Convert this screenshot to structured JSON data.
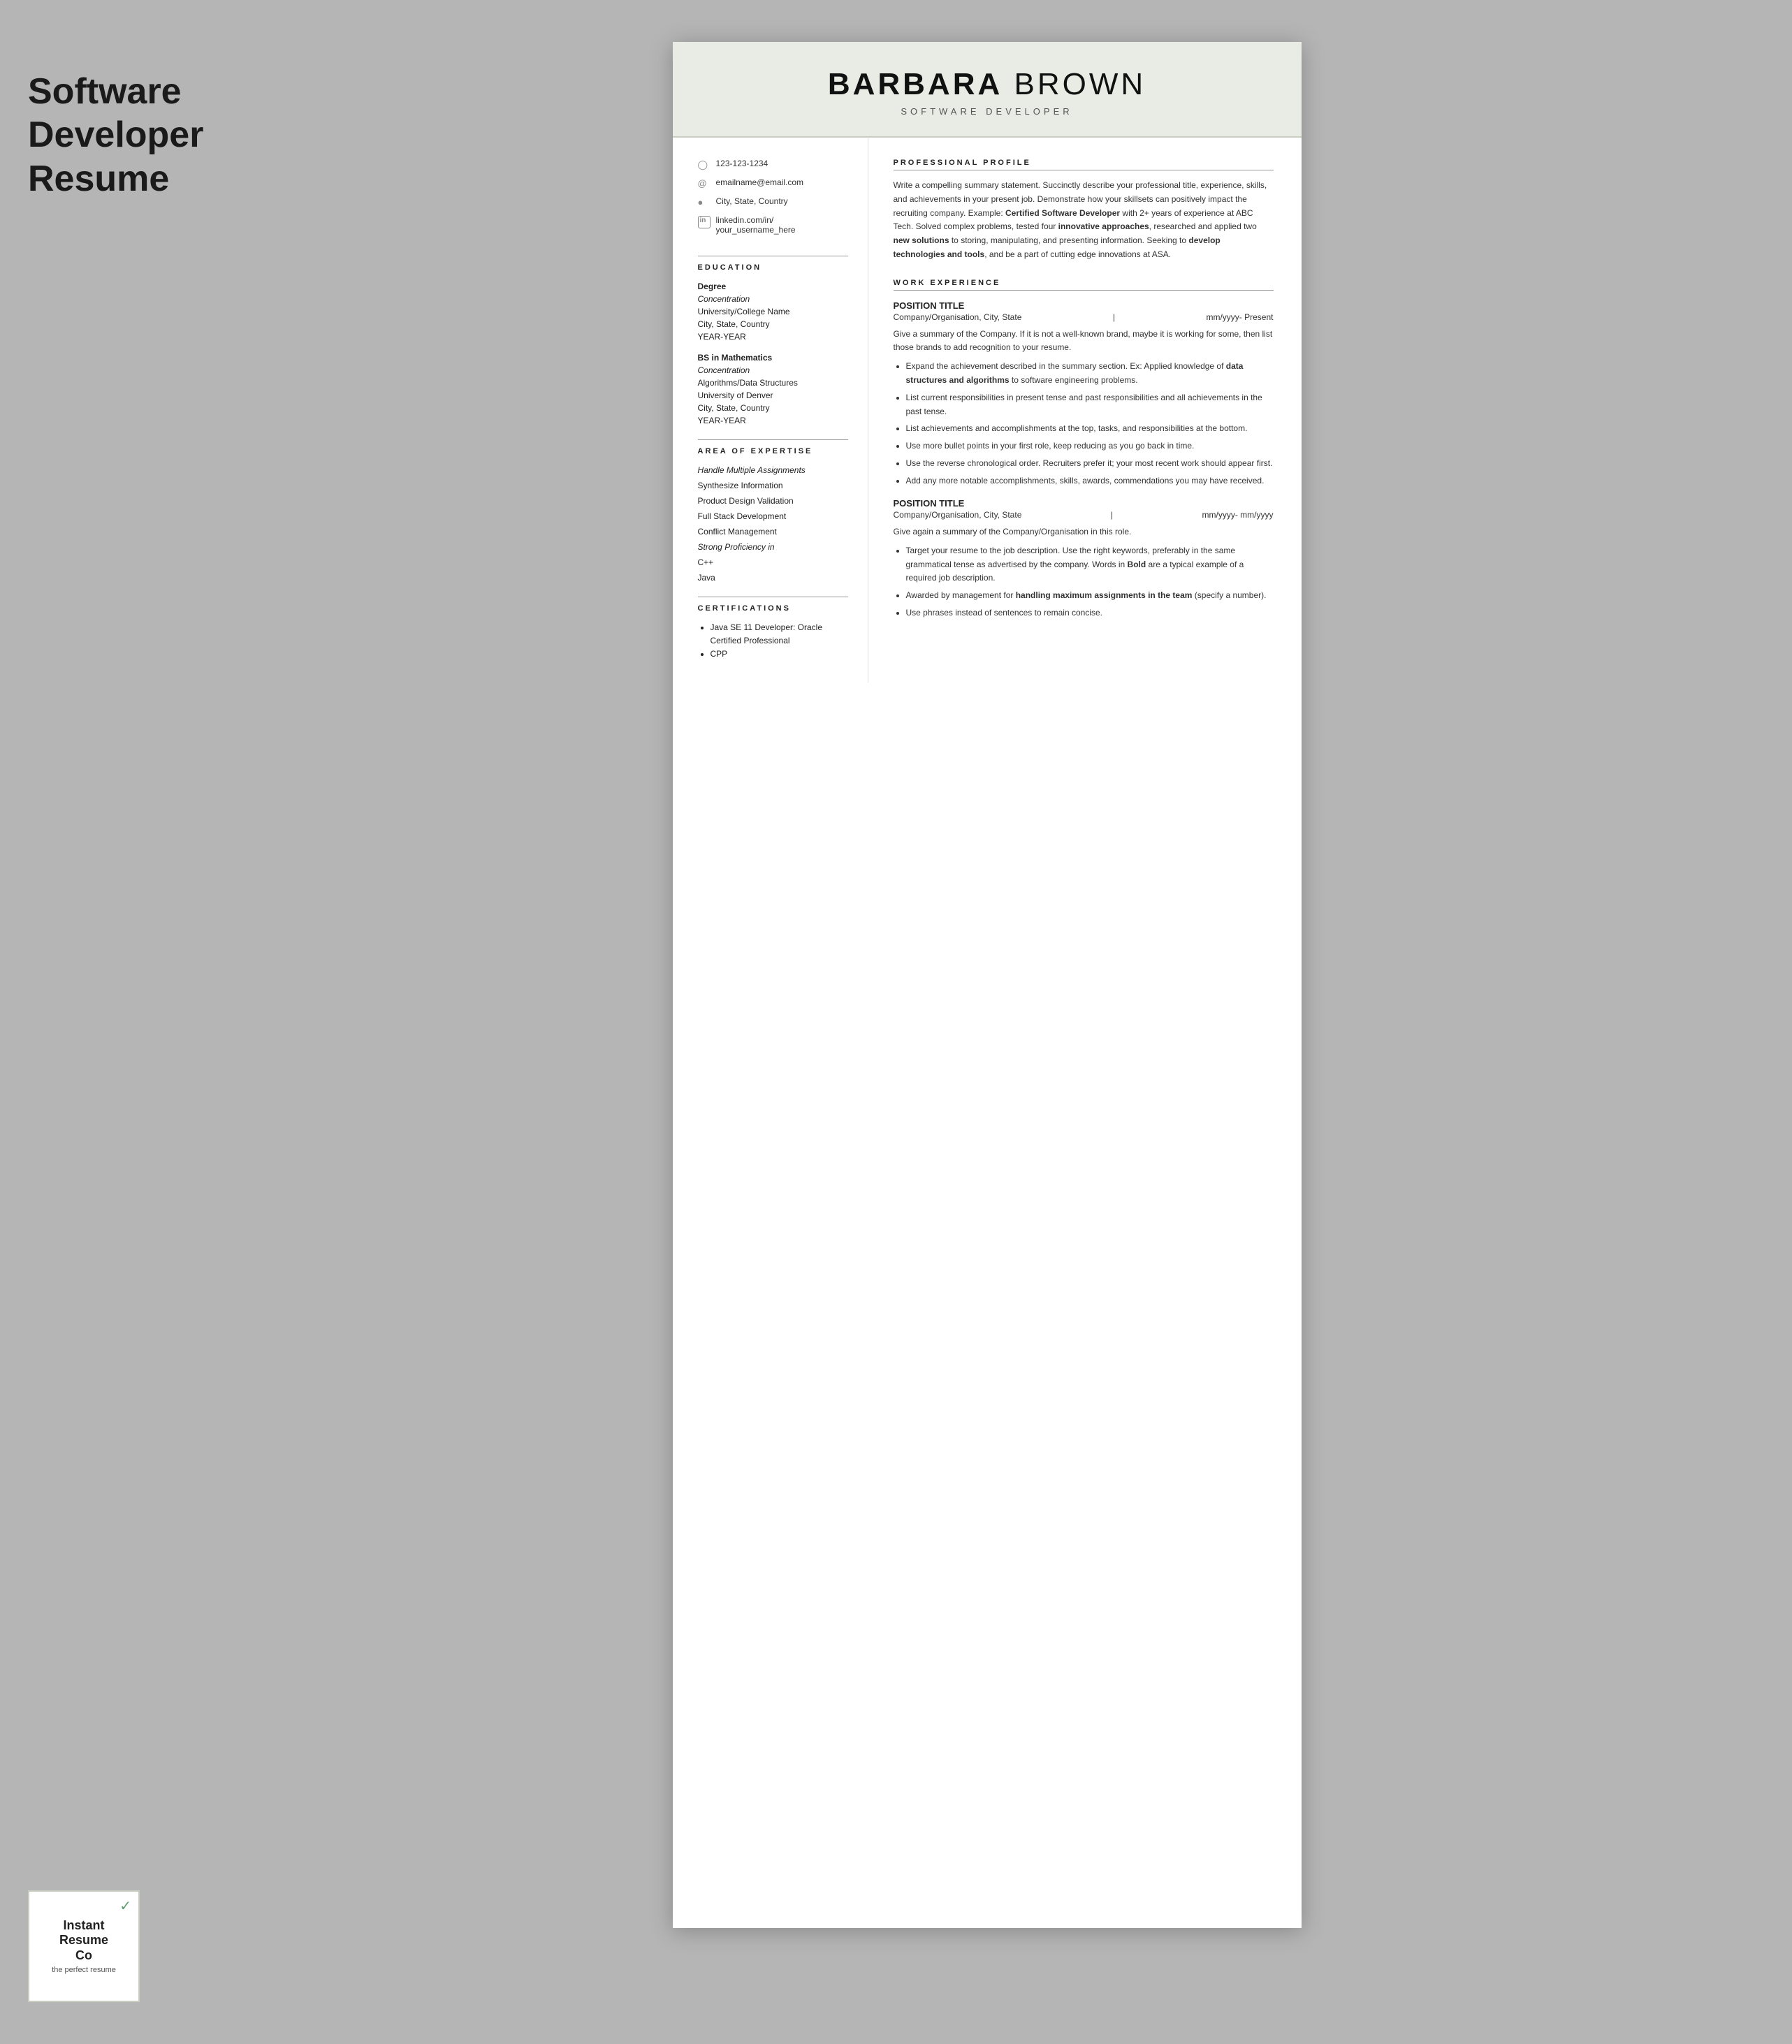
{
  "leftLabel": {
    "line1": "Software",
    "line2": "Developer",
    "line3": "Resume"
  },
  "header": {
    "firstName": "BARBARA",
    "lastName": "BROWN",
    "jobTitle": "SOFTWARE DEVELOPER"
  },
  "contact": {
    "phone": "123-123-1234",
    "email": "emailname@email.com",
    "location": "City, State, Country",
    "linkedin": "linkedin.com/in/ your_username_here"
  },
  "education": {
    "sectionTitle": "EDUCATION",
    "entries": [
      {
        "degree": "Degree",
        "concentration": "Concentration",
        "school": "University/College Name",
        "cityState": "City, State, Country",
        "years": "YEAR-YEAR"
      },
      {
        "degree": "BS in Mathematics",
        "concentration": "Concentration",
        "school": "Algorithms/Data Structures",
        "university": "University of Denver",
        "cityState": "City, State, Country",
        "years": "YEAR-YEAR"
      }
    ]
  },
  "expertise": {
    "sectionTitle": "AREA OF EXPERTISE",
    "items": [
      {
        "text": "Handle Multiple Assignments",
        "italic": true
      },
      {
        "text": "Synthesize Information",
        "italic": false
      },
      {
        "text": "Product Design Validation",
        "italic": false
      },
      {
        "text": "Full Stack Development",
        "italic": false
      },
      {
        "text": "Conflict Management",
        "italic": false
      },
      {
        "text": "Strong Proficiency in",
        "italic": true
      },
      {
        "text": "C++",
        "italic": false
      },
      {
        "text": "Java",
        "italic": false
      }
    ]
  },
  "certifications": {
    "sectionTitle": "CERTIFICATIONS",
    "items": [
      "Java SE 11 Developer: Oracle Certified Professional",
      "CPP"
    ]
  },
  "professionalProfile": {
    "sectionTitle": "PROFESSIONAL PROFILE",
    "text": "Write a compelling summary statement. Succinctly describe your professional title, experience, skills, and achievements in your present job. Demonstrate how your skillsets can positively impact the recruiting company. Example: Certified Software Developer with 2+ years of experience at ABC Tech. Solved complex problems, tested four innovative approaches, researched and applied two new solutions to storing, manipulating, and presenting information. Seeking to develop technologies and tools, and be a part of cutting edge innovations at ASA."
  },
  "workExperience": {
    "sectionTitle": "WORK EXPERIENCE",
    "positions": [
      {
        "title": "POSITION TITLE",
        "company": "Company/Organisation, City, State",
        "dates": "mm/yyyy- Present",
        "summary": "Give a summary of the Company. If it is not a well-known brand, maybe it is working for some, then list those brands to add recognition to your resume.",
        "bullets": [
          "Expand the achievement described in the summary section. Ex: Applied knowledge of data structures and algorithms to software engineering problems.",
          "List current responsibilities in present tense and past responsibilities and all achievements in the past tense.",
          "List achievements and accomplishments at the top, tasks, and responsibilities at the bottom.",
          "Use more bullet points in your first role, keep reducing as you go back in time.",
          "Use the reverse chronological order. Recruiters prefer it; your most recent work should appear first.",
          "Add any more notable accomplishments, skills, awards, commendations you may have received."
        ]
      },
      {
        "title": "POSITION TITLE",
        "company": "Company/Organisation, City, State",
        "dates": "mm/yyyy- mm/yyyy",
        "summary": "Give again a summary of the Company/Organisation in this role.",
        "bullets": [
          "Target your resume to the job description. Use the right keywords, preferably in the same grammatical tense as advertised by the company. Words in Bold are a typical example of a required job description.",
          "Awarded by management for handling maximum assignments in the team (specify a number).",
          "Use phrases instead of sentences to remain concise."
        ]
      }
    ]
  },
  "logo": {
    "line1": "Instant",
    "line2": "Resume",
    "line3": "Co",
    "tagline": "the perfect resume"
  }
}
